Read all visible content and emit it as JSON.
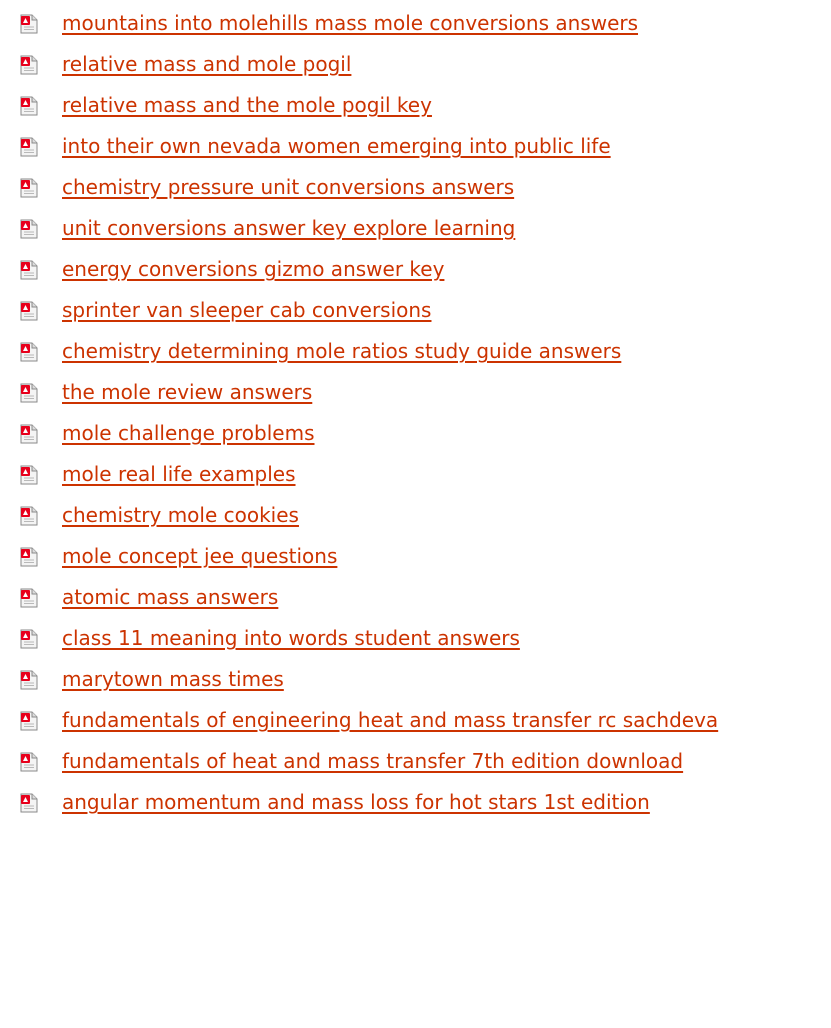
{
  "icon": {
    "name": "pdf-file-icon",
    "accent": "#e8001c"
  },
  "link_color": "#cc3300",
  "links": [
    {
      "label": "mountains into molehills mass mole conversions answers"
    },
    {
      "label": "relative mass and mole pogil"
    },
    {
      "label": "relative mass and the mole pogil key"
    },
    {
      "label": "into their own nevada women emerging into public life"
    },
    {
      "label": "chemistry pressure unit conversions answers"
    },
    {
      "label": "unit conversions answer key explore learning"
    },
    {
      "label": "energy conversions gizmo answer key"
    },
    {
      "label": "sprinter van sleeper cab conversions"
    },
    {
      "label": "chemistry determining mole ratios study guide answers"
    },
    {
      "label": "the mole review answers"
    },
    {
      "label": "mole challenge problems"
    },
    {
      "label": "mole real life examples"
    },
    {
      "label": "chemistry mole cookies"
    },
    {
      "label": "mole concept jee questions"
    },
    {
      "label": "atomic mass answers"
    },
    {
      "label": "class 11 meaning into words student answers"
    },
    {
      "label": "marytown mass times"
    },
    {
      "label": "fundamentals of engineering heat and mass transfer rc sachdeva"
    },
    {
      "label": "fundamentals of heat and mass transfer 7th edition download"
    },
    {
      "label": "angular momentum and mass loss for hot stars 1st edition"
    }
  ]
}
